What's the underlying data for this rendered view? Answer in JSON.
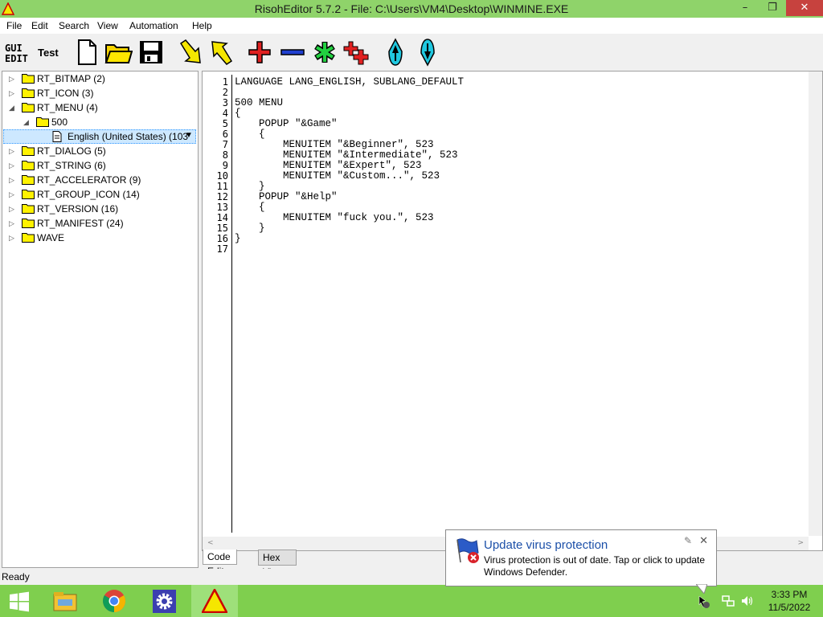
{
  "window": {
    "title": "RisohEditor 5.7.2 - File: C:\\Users\\VM4\\Desktop\\WINMINE.EXE",
    "min": "–",
    "max": "❐",
    "close": "✕"
  },
  "menu": [
    "File",
    "Edit",
    "Search",
    "View",
    "Automation",
    "Help"
  ],
  "toolbar": {
    "gui_edit_1": "GUI",
    "gui_edit_2": "EDIT",
    "test": "Test"
  },
  "tree": [
    {
      "label": "RT_BITMAP (2)"
    },
    {
      "label": "RT_ICON (3)"
    },
    {
      "label": "RT_MENU (4)"
    },
    {
      "label": "500"
    },
    {
      "label": "English (United States) (103"
    },
    {
      "label": "RT_DIALOG (5)"
    },
    {
      "label": "RT_STRING (6)"
    },
    {
      "label": "RT_ACCELERATOR (9)"
    },
    {
      "label": "RT_GROUP_ICON (14)"
    },
    {
      "label": "RT_VERSION (16)"
    },
    {
      "label": "RT_MANIFEST (24)"
    },
    {
      "label": "WAVE"
    }
  ],
  "code": {
    "line_numbers": [
      "1",
      "2",
      "3",
      "4",
      "5",
      "6",
      "7",
      "8",
      "9",
      "10",
      "11",
      "12",
      "13",
      "14",
      "15",
      "16",
      "17"
    ],
    "lines": [
      "LANGUAGE LANG_ENGLISH, SUBLANG_DEFAULT",
      "",
      "500 MENU",
      "{",
      "    POPUP \"&Game\"",
      "    {",
      "        MENUITEM \"&Beginner\", 523",
      "        MENUITEM \"&Intermediate\", 523",
      "        MENUITEM \"&Expert\", 523",
      "        MENUITEM \"&Custom...\", 523",
      "    }",
      "    POPUP \"&Help\"",
      "    {",
      "        MENUITEM \"fuck you.\", 523",
      "    }",
      "}",
      ""
    ]
  },
  "tabs": [
    "Code Editor",
    "Hex Viewer"
  ],
  "status": "Ready",
  "notification": {
    "title": "Update virus protection",
    "body": "Virus protection is out of date. Tap or click to update Windows Defender."
  },
  "clock": {
    "time": "3:33 PM",
    "date": "11/5/2022"
  }
}
